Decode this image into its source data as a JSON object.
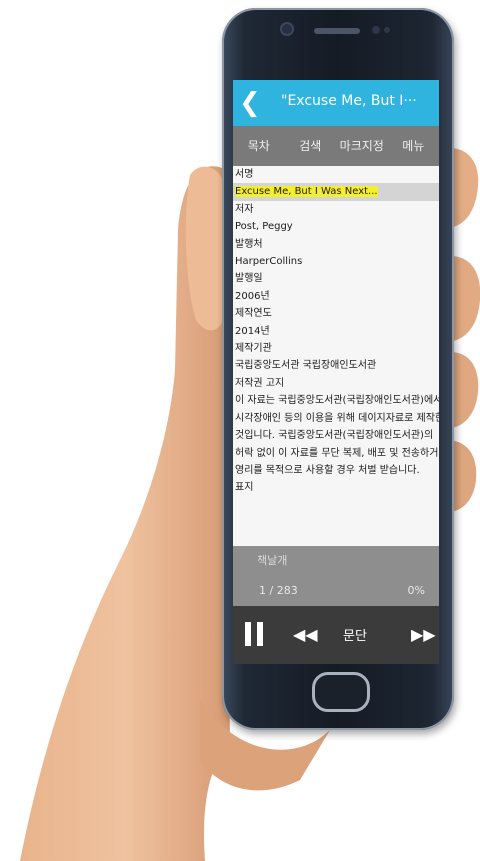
{
  "header": {
    "back_icon": "chevron-left-icon",
    "title": "\"Excuse Me, But I···"
  },
  "menu": [
    "목차",
    "검색",
    "마크지정",
    "메뉴"
  ],
  "content": {
    "lines": [
      {
        "text": "서명",
        "highlight": false
      },
      {
        "text": "Excuse Me, But I Was Next...",
        "highlight": true
      },
      {
        "text": "저자",
        "highlight": false
      },
      {
        "text": "Post, Peggy",
        "highlight": false
      },
      {
        "text": "발행처",
        "highlight": false
      },
      {
        "text": "HarperCollins",
        "highlight": false
      },
      {
        "text": "발행일",
        "highlight": false
      },
      {
        "text": "2006년",
        "highlight": false
      },
      {
        "text": "제작연도",
        "highlight": false
      },
      {
        "text": "2014년",
        "highlight": false
      },
      {
        "text": "제작기관",
        "highlight": false
      },
      {
        "text": "국립중앙도서관 국립장애인도서관",
        "highlight": false
      },
      {
        "text": "저작권 고지",
        "highlight": false
      },
      {
        "text": "이 자료는 국립중앙도서관(국립장애인도서관)에서",
        "highlight": false
      },
      {
        "text": "시각장애인 등의 이용을 위해 데이지자료로 제작한",
        "highlight": false
      },
      {
        "text": "것입니다. 국립중앙도서관(국립장애인도서관)의",
        "highlight": false
      },
      {
        "text": "허락 없이 이 자료를 무단 복제, 배포 및 전송하거나",
        "highlight": false
      },
      {
        "text": "영리를 목적으로 사용할 경우 처벌 받습니다.",
        "highlight": false
      },
      {
        "text": "표지",
        "highlight": false
      }
    ]
  },
  "player": {
    "label": "책날개",
    "progress": "1 / 283",
    "percent": "0%"
  },
  "controls": {
    "pause_icon": "pause-icon",
    "prev_icon": "skip-back-icon",
    "mode_label": "문단",
    "next_icon": "skip-forward-icon"
  },
  "colors": {
    "titlebar": "#2fb4e0",
    "highlight": "#f4ef2c",
    "menubar": "#7a7a7a",
    "controls": "#3b3b3b"
  }
}
